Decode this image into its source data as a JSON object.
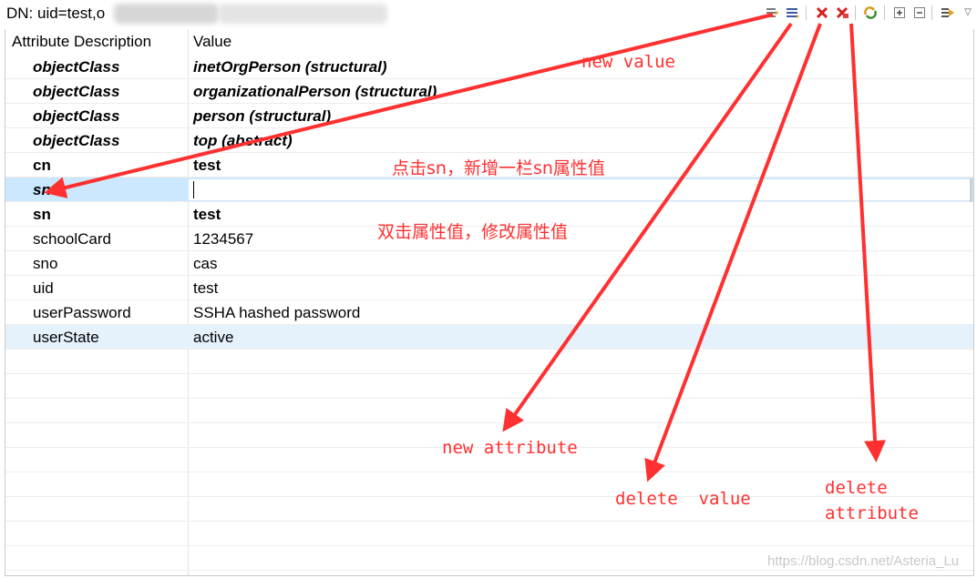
{
  "header": {
    "dn_text": "DN: uid=test,o"
  },
  "toolbar": {
    "icons": [
      "new-value-icon",
      "new-attribute-icon",
      "delete-value-icon",
      "delete-attribute-icon",
      "refresh-icon",
      "expand-all-icon",
      "collapse-all-icon",
      "open-menu-icon",
      "view-menu-chevron-icon"
    ]
  },
  "table": {
    "columns": [
      "Attribute Description",
      "Value"
    ],
    "rows": [
      {
        "attr": "objectClass",
        "value": "inetOrgPerson (structural)",
        "style": "bi"
      },
      {
        "attr": "objectClass",
        "value": "organizationalPerson (structural)",
        "style": "bi"
      },
      {
        "attr": "objectClass",
        "value": "person (structural)",
        "style": "bi"
      },
      {
        "attr": "objectClass",
        "value": "top (abstract)",
        "style": "bi"
      },
      {
        "attr": "cn",
        "value": "test",
        "style": "b"
      },
      {
        "attr": "sn",
        "value": "",
        "style": "editing"
      },
      {
        "attr": "sn",
        "value": "test",
        "style": "b"
      },
      {
        "attr": "schoolCard",
        "value": "1234567",
        "style": ""
      },
      {
        "attr": "sno",
        "value": "cas",
        "style": ""
      },
      {
        "attr": "uid",
        "value": "test",
        "style": ""
      },
      {
        "attr": "userPassword",
        "value": "SSHA hashed password",
        "style": ""
      },
      {
        "attr": "userState",
        "value": "active",
        "style": ""
      }
    ]
  },
  "annotations": {
    "new_value": "new value",
    "click_sn": "点击sn，新增一栏sn属性值",
    "double_click": "双击属性值，修改属性值",
    "new_attribute": "new attribute",
    "delete_value": "delete  value",
    "delete_attribute_1": "delete",
    "delete_attribute_2": "attribute",
    "color": "#ff3030"
  },
  "watermark": "https://blog.csdn.net/Asteria_Lu"
}
